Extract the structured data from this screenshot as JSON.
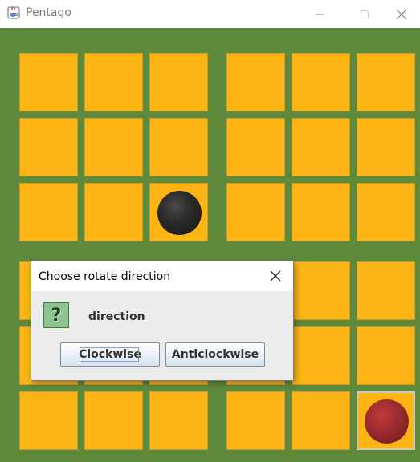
{
  "window": {
    "title": "Pentago",
    "controls": [
      "minimize",
      "maximize",
      "close"
    ]
  },
  "board": {
    "rows": 6,
    "cols": 6,
    "marbles": [
      {
        "row": 3,
        "col": 3,
        "color": "black"
      },
      {
        "row": 6,
        "col": 6,
        "color": "red",
        "highlighted": true
      }
    ],
    "colors": {
      "background": "#5f8a3c",
      "cell": "#fdb515",
      "black_marble": "#222222",
      "red_marble": "#9a2a2f"
    }
  },
  "dialog": {
    "title": "Choose rotate direction",
    "icon": "question-icon",
    "message": "direction",
    "buttons": {
      "clockwise": "Clockwise",
      "anticlockwise": "Anticlockwise"
    },
    "focused_button": "clockwise"
  }
}
